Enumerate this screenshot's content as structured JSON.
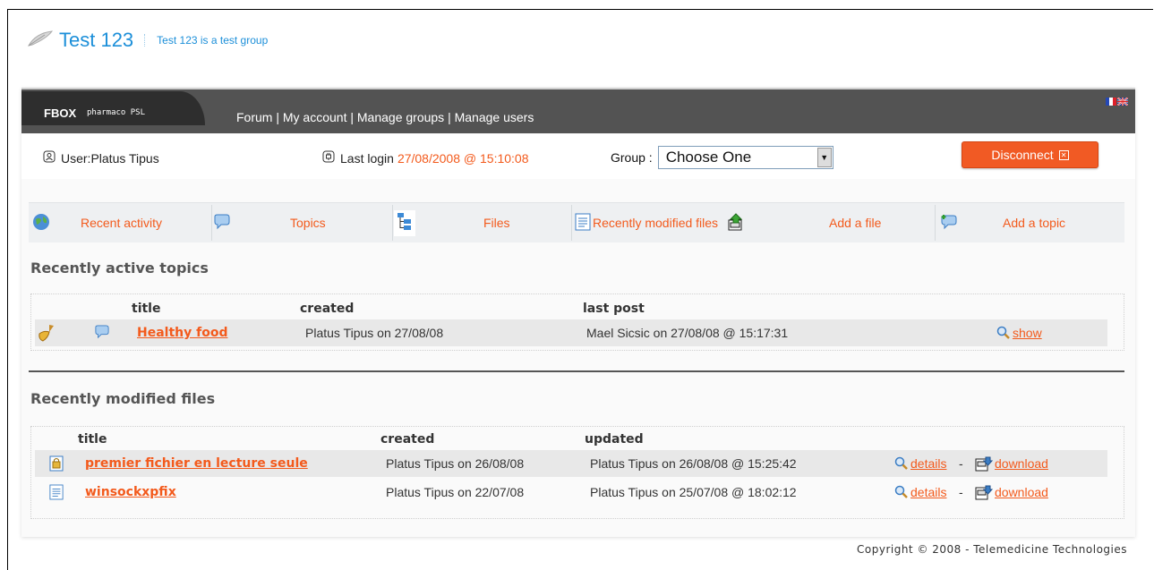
{
  "header": {
    "title": "Test 123",
    "subtitle": "Test 123 is a test group"
  },
  "nav": {
    "brand": "FBOX",
    "brand_sub": "pharmaco PSL",
    "links": [
      "Forum",
      "My account",
      "Manage groups",
      "Manage users"
    ],
    "separator": " | "
  },
  "userbar": {
    "user_label": "User:Platus Tipus",
    "last_login_label": "Last login",
    "last_login_date": "27/08/2008 @ 15:10:08",
    "group_label": "Group :",
    "group_selected": "Choose One",
    "disconnect_label": "Disconnect"
  },
  "toolbar": {
    "items": [
      {
        "label": "Recent activity",
        "icon": "globe-icon"
      },
      {
        "label": "Topics",
        "icon": "speech-bubble-icon"
      },
      {
        "label": "Files",
        "icon": "file-tree-icon"
      },
      {
        "label": "Recently modified files",
        "icon": "document-icon"
      },
      {
        "label": "Add a file",
        "icon": "upload-icon"
      },
      {
        "label": "Add a topic",
        "icon": "add-bubble-icon"
      }
    ]
  },
  "topics": {
    "section_title": "Recently active topics",
    "columns": [
      "title",
      "created",
      "last post"
    ],
    "rows": [
      {
        "title": "Healthy food",
        "created": "Platus Tipus on 27/08/08",
        "last_post": "Mael Sicsic on 27/08/08 @ 15:17:31",
        "action": "show"
      }
    ]
  },
  "files": {
    "section_title": "Recently modified files",
    "columns": [
      "title",
      "created",
      "updated"
    ],
    "rows": [
      {
        "title": "premier fichier en lecture seule",
        "created": "Platus Tipus on 26/08/08",
        "updated": "Platus Tipus on 26/08/08 @ 15:25:42",
        "details": "details",
        "dash": "-",
        "download": "download"
      },
      {
        "title": "winsockxpfix",
        "created": "Platus Tipus on 22/07/08",
        "updated": "Platus Tipus on 25/07/08 @ 18:02:12",
        "details": "details",
        "dash": "-",
        "download": "download"
      }
    ]
  },
  "footer": {
    "copyright": "Copyright © 2008 - Telemedicine Technologies"
  },
  "colors": {
    "accent_orange": "#f35a1c",
    "title_blue": "#1c8fd9",
    "nav_dark": "#535353"
  }
}
